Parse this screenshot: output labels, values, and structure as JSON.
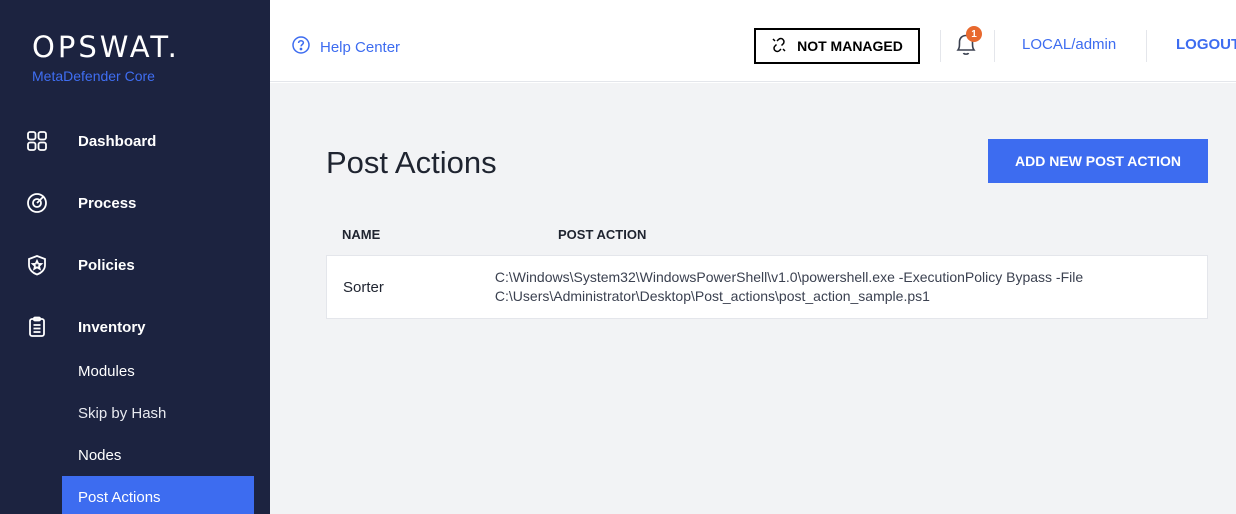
{
  "brand": {
    "logo": "OPSWAT.",
    "product": "MetaDefender Core"
  },
  "sidebar": {
    "items": [
      {
        "label": "Dashboard",
        "icon": "dashboard-icon"
      },
      {
        "label": "Process",
        "icon": "process-icon"
      },
      {
        "label": "Policies",
        "icon": "policies-icon"
      },
      {
        "label": "Inventory",
        "icon": "inventory-icon"
      }
    ],
    "subitems": [
      {
        "label": "Modules"
      },
      {
        "label": "Skip by Hash"
      },
      {
        "label": "Nodes"
      },
      {
        "label": "Post Actions",
        "active": true
      }
    ]
  },
  "topbar": {
    "help_label": "Help Center",
    "status_label": "NOT MANAGED",
    "notification_count": "1",
    "user_label": "LOCAL/admin",
    "logout_label": "LOGOUT"
  },
  "main": {
    "title": "Post Actions",
    "add_button_label": "ADD NEW POST ACTION",
    "table": {
      "columns": [
        "NAME",
        "POST ACTION"
      ],
      "rows": [
        {
          "name": "Sorter",
          "post_action": "C:\\Windows\\System32\\WindowsPowerShell\\v1.0\\powershell.exe -ExecutionPolicy Bypass -File C:\\Users\\Administrator\\Desktop\\Post_actions\\post_action_sample.ps1"
        }
      ]
    }
  },
  "colors": {
    "sidebar_bg": "#1c2340",
    "accent": "#3d6cf0",
    "badge": "#e8692e",
    "main_bg": "#f2f3f5"
  }
}
